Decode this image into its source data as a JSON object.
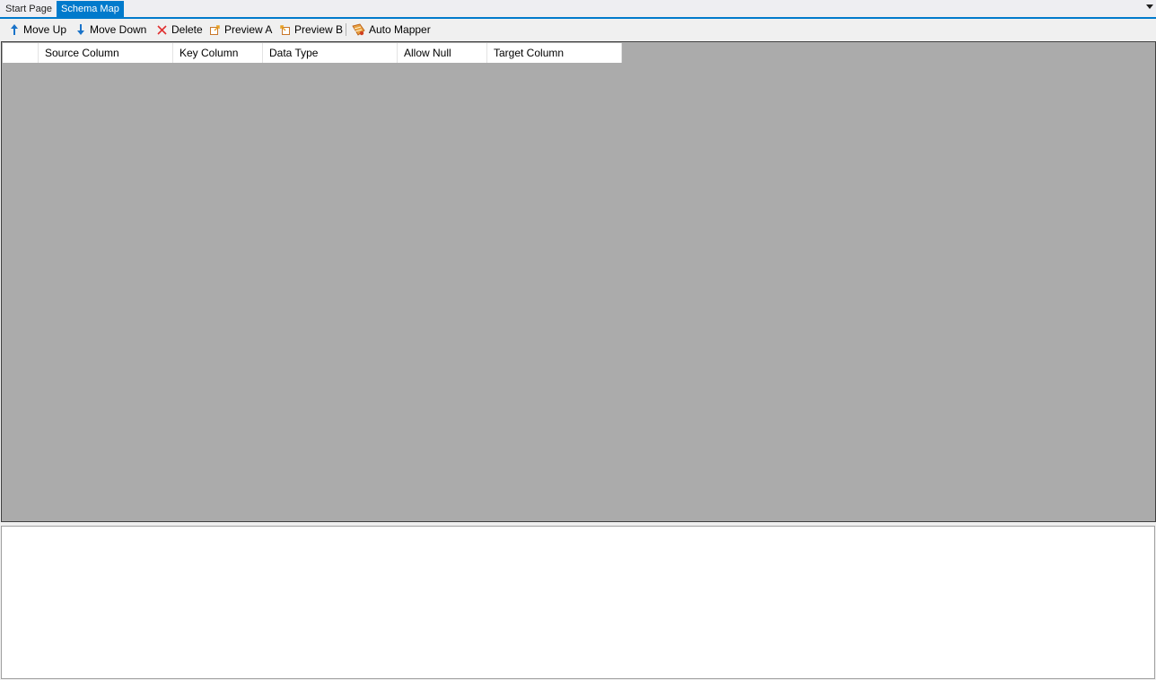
{
  "tabs": {
    "start_page": "Start Page",
    "schema_map": "Schema Map"
  },
  "toolbar": {
    "move_up": "Move Up",
    "move_down": "Move Down",
    "delete": "Delete",
    "preview_a": "Preview A",
    "preview_b": "Preview B",
    "auto_mapper": "Auto Mapper"
  },
  "grid": {
    "columns": [
      "",
      "Source Column",
      "Key Column",
      "Data Type",
      "Allow Null",
      "Target Column"
    ],
    "rows": []
  },
  "colors": {
    "accent": "#007acc",
    "grid_background": "#ababab",
    "delete_icon": "#e03030",
    "arrow_icon": "#1a73c9"
  }
}
